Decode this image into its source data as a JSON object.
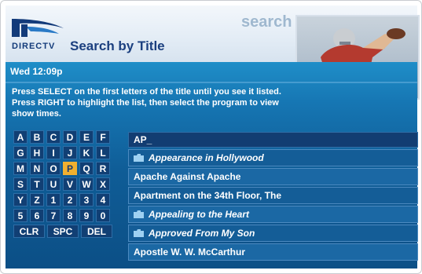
{
  "brand": {
    "logo_text": "DIRECTV"
  },
  "header": {
    "page_title": "Search by Title",
    "section_label": "search"
  },
  "status": {
    "clock": "Wed 12:09p"
  },
  "instructions": "Press SELECT on the first letters of the title until you see it listed. Press RIGHT to highlight the list, then select the program to view show times.",
  "keyboard": {
    "rows": [
      [
        "A",
        "B",
        "C",
        "D",
        "E",
        "F"
      ],
      [
        "G",
        "H",
        "I",
        "J",
        "K",
        "L"
      ],
      [
        "M",
        "N",
        "O",
        "P",
        "Q",
        "R"
      ],
      [
        "S",
        "T",
        "U",
        "V",
        "W",
        "X"
      ],
      [
        "Y",
        "Z",
        "1",
        "2",
        "3",
        "4"
      ],
      [
        "5",
        "6",
        "7",
        "8",
        "9",
        "0"
      ]
    ],
    "selected": "P",
    "actions": [
      "CLR",
      "SPC",
      "DEL"
    ]
  },
  "search": {
    "query": "AP_"
  },
  "results": [
    {
      "title": "Appearance in Hollywood",
      "folder": true
    },
    {
      "title": "Apache Against Apache",
      "folder": false
    },
    {
      "title": "Apartment on the 34th Floor, The",
      "folder": false
    },
    {
      "title": "Appealing to the Heart",
      "folder": true
    },
    {
      "title": "Approved From My Son",
      "folder": true
    },
    {
      "title": "Apostle W. W. McCarthur",
      "folder": false
    }
  ],
  "thumbnail": {
    "icon": "football-player-image"
  },
  "colors": {
    "accent": "#f0b02f",
    "panel": "#1b68a4",
    "navy": "#123d72"
  }
}
